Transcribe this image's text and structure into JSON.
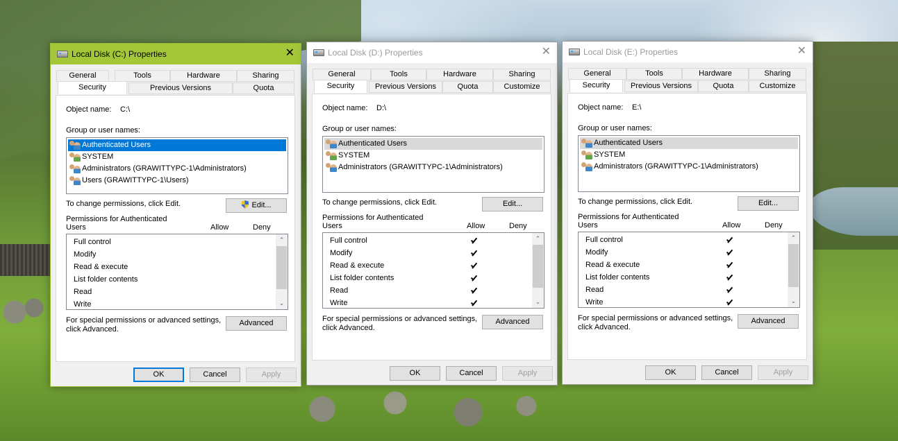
{
  "dialogs": [
    {
      "title": "Local Disk (C:) Properties",
      "tabs_row1": [
        "General",
        "Tools",
        "Hardware",
        "Sharing"
      ],
      "tabs_row2": [
        "Security",
        "Previous Versions",
        "Quota"
      ],
      "object_name_label": "Object name:",
      "object_name_value": "C:\\",
      "group_label": "Group or user names:",
      "users": [
        "Authenticated Users",
        "SYSTEM",
        "Administrators (GRAWITTYPC-1\\Administrators)",
        "Users (GRAWITTYPC-1\\Users)"
      ],
      "change_text": "To change permissions, click Edit.",
      "edit_label": "Edit...",
      "perm_label_1": "Permissions for Authenticated",
      "perm_label_2": "Users",
      "allow_label": "Allow",
      "deny_label": "Deny",
      "permissions": [
        "Full control",
        "Modify",
        "Read & execute",
        "List folder contents",
        "Read",
        "Write"
      ],
      "allow_checked": [
        false,
        false,
        false,
        false,
        false,
        false
      ],
      "special_text_1": "For special permissions or advanced settings,",
      "special_text_2": "click Advanced.",
      "advanced_label": "Advanced",
      "ok_label": "OK",
      "cancel_label": "Cancel",
      "apply_label": "Apply"
    },
    {
      "title": "Local Disk (D:) Properties",
      "tabs_row1": [
        "General",
        "Tools",
        "Hardware",
        "Sharing"
      ],
      "tabs_row2": [
        "Security",
        "Previous Versions",
        "Quota",
        "Customize"
      ],
      "object_name_label": "Object name:",
      "object_name_value": "D:\\",
      "group_label": "Group or user names:",
      "users": [
        "Authenticated Users",
        "SYSTEM",
        "Administrators (GRAWITTYPC-1\\Administrators)"
      ],
      "change_text": "To change permissions, click Edit.",
      "edit_label": "Edit...",
      "perm_label_1": "Permissions for Authenticated",
      "perm_label_2": "Users",
      "allow_label": "Allow",
      "deny_label": "Deny",
      "permissions": [
        "Full control",
        "Modify",
        "Read & execute",
        "List folder contents",
        "Read",
        "Write"
      ],
      "allow_checked": [
        true,
        true,
        true,
        true,
        true,
        true
      ],
      "special_text_1": "For special permissions or advanced settings,",
      "special_text_2": "click Advanced.",
      "advanced_label": "Advanced",
      "ok_label": "OK",
      "cancel_label": "Cancel",
      "apply_label": "Apply"
    },
    {
      "title": "Local Disk (E:) Properties",
      "tabs_row1": [
        "General",
        "Tools",
        "Hardware",
        "Sharing"
      ],
      "tabs_row2": [
        "Security",
        "Previous Versions",
        "Quota",
        "Customize"
      ],
      "object_name_label": "Object name:",
      "object_name_value": "E:\\",
      "group_label": "Group or user names:",
      "users": [
        "Authenticated Users",
        "SYSTEM",
        "Administrators (GRAWITTYPC-1\\Administrators)"
      ],
      "change_text": "To change permissions, click Edit.",
      "edit_label": "Edit...",
      "perm_label_1": "Permissions for Authenticated",
      "perm_label_2": "Users",
      "allow_label": "Allow",
      "deny_label": "Deny",
      "permissions": [
        "Full control",
        "Modify",
        "Read & execute",
        "List folder contents",
        "Read",
        "Write"
      ],
      "allow_checked": [
        true,
        true,
        true,
        true,
        true,
        true
      ],
      "special_text_1": "For special permissions or advanced settings,",
      "special_text_2": "click Advanced.",
      "advanced_label": "Advanced",
      "ok_label": "OK",
      "cancel_label": "Cancel",
      "apply_label": "Apply"
    }
  ],
  "colors": {
    "active_titlebar": "#a4c639",
    "selection_blue": "#0078d7"
  },
  "icons": [
    "hard-drive-icon",
    "users-group-icon",
    "uac-shield-icon",
    "checkmark-icon",
    "close-icon",
    "scroll-up-arrow-icon",
    "scroll-down-arrow-icon"
  ]
}
